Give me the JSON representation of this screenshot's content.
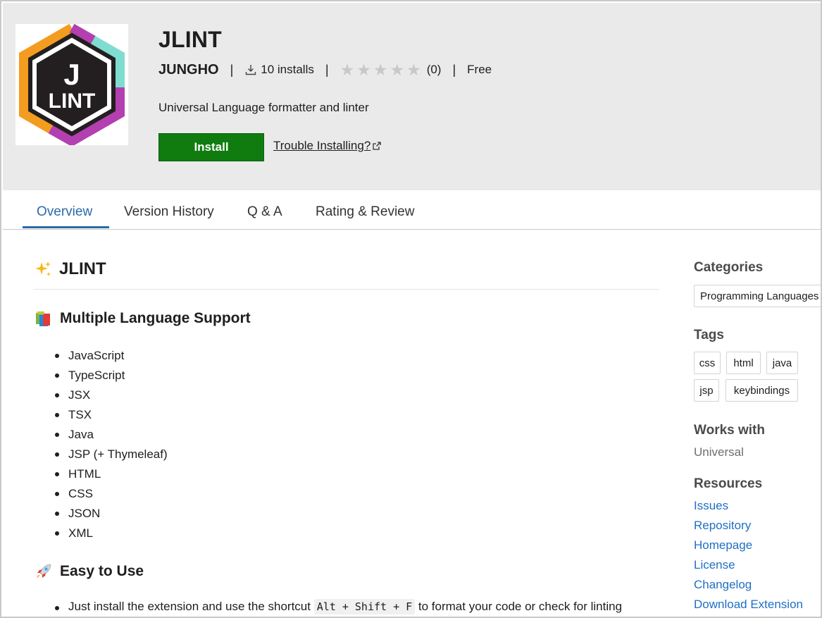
{
  "extension": {
    "name": "JLINT",
    "publisher": "JUNGHO",
    "installs": "10 installs",
    "rating_count": "(0)",
    "stars_filled": 0,
    "stars_total": 5,
    "price": "Free",
    "description": "Universal Language formatter and linter",
    "install_label": "Install",
    "trouble_label": "Trouble Installing?",
    "logo": {
      "top": "J",
      "bottom": "LINT"
    }
  },
  "tabs": [
    {
      "label": "Overview",
      "active": true
    },
    {
      "label": "Version History",
      "active": false
    },
    {
      "label": "Q & A",
      "active": false
    },
    {
      "label": "Rating & Review",
      "active": false
    }
  ],
  "content": {
    "heading": "JLINT",
    "heading_icon": "sparkles-icon",
    "section1": {
      "title": "Multiple Language Support",
      "icon": "books-icon"
    },
    "languages": [
      "JavaScript",
      "TypeScript",
      "JSX",
      "TSX",
      "Java",
      "JSP (+ Thymeleaf)",
      "HTML",
      "CSS",
      "JSON",
      "XML"
    ],
    "section2": {
      "title": "Easy to Use",
      "icon": "rocket-icon"
    },
    "easy": {
      "before": "Just install the extension and use the shortcut ",
      "shortcut": "Alt + Shift + F",
      "after": " to format your code or check for linting"
    }
  },
  "sidebar": {
    "categories_title": "Categories",
    "categories": [
      "Programming Languages"
    ],
    "tags_title": "Tags",
    "tags": [
      "css",
      "html",
      "java",
      "jsp",
      "keybindings"
    ],
    "works_with_title": "Works with",
    "works_with": "Universal",
    "resources_title": "Resources",
    "resources": [
      "Issues",
      "Repository",
      "Homepage",
      "License",
      "Changelog",
      "Download Extension"
    ]
  },
  "colors": {
    "install_green": "#107c10",
    "link_blue": "#1f6fc4",
    "tab_active": "#2b6aa8",
    "header_bg": "#eaeaeb",
    "logo_orange": "#f39c1f",
    "logo_purple": "#b43fb0",
    "logo_teal": "#7fdcd0"
  }
}
